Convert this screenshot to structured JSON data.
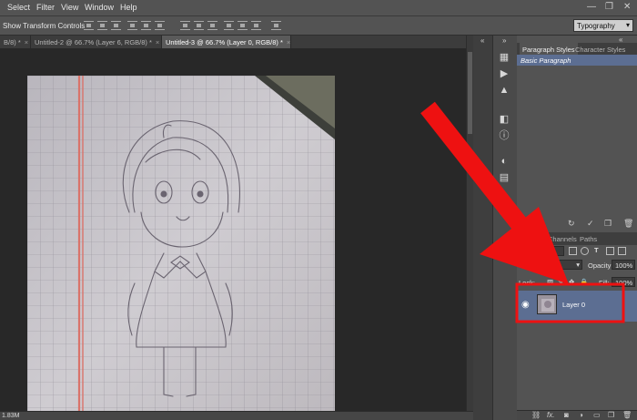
{
  "menu": [
    "Select",
    "Filter",
    "View",
    "Window",
    "Help"
  ],
  "options_bar": {
    "show_transform_controls": "Show Transform Controls",
    "workspace": "Typography"
  },
  "tabs": [
    {
      "label": "B/8) *",
      "close": "×"
    },
    {
      "label": "Untitled-2 @ 66.7% (Layer 6, RGB/8) *",
      "close": "×"
    },
    {
      "label": "Untitled-3 @ 66.7% (Layer 0, RGB/8) *",
      "close": "×"
    }
  ],
  "status": {
    "doc_size": "1.83M"
  },
  "paragraph_panel": {
    "tabs": [
      "Paragraph Styles",
      "Character Styles"
    ],
    "selected_style": "Basic Paragraph"
  },
  "layers_panel": {
    "tabs": [
      "Layers",
      "Channels",
      "Paths"
    ],
    "filter_kind": "Kind",
    "blend_mode": "Normal",
    "opacity_label": "Opacity:",
    "opacity_value": "100%",
    "lock_label": "Lock:",
    "fill_label": "Fill:",
    "fill_value": "100%",
    "layers": [
      {
        "name": "Layer 0",
        "visible": true
      }
    ]
  },
  "annotation": {
    "arrow_color": "#ee1111",
    "highlight_color": "#ee1111"
  },
  "icons": [
    "eye-icon",
    "history-icon",
    "play-icon",
    "histogram-icon",
    "info-icon",
    "color-icon",
    "swatches-icon",
    "adjustments-icon",
    "brush-icon",
    "link-icon",
    "fx-icon",
    "mask-icon",
    "folder-icon",
    "new-layer-icon",
    "trash-icon"
  ]
}
